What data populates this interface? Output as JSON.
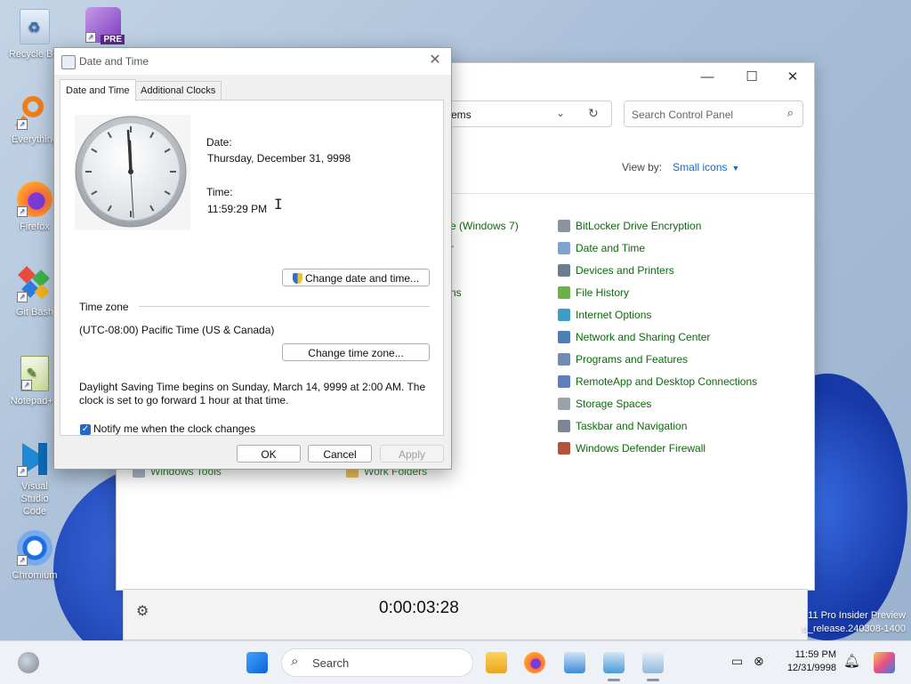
{
  "desktop": {
    "icons": [
      {
        "label": "Recycle Bin",
        "icon": "recycle-bin-icon"
      },
      {
        "label": "Everything",
        "icon": "everything-search-icon"
      },
      {
        "label": "Firefox",
        "icon": "firefox-icon"
      },
      {
        "label": "Git Bash",
        "icon": "git-bash-icon"
      },
      {
        "label": "Notepad++",
        "icon": "notepad-plus-plus-icon"
      },
      {
        "label": "Visual Studio Code",
        "icon": "vscode-icon"
      },
      {
        "label": "Chromium",
        "icon": "chromium-icon"
      }
    ],
    "vs_preview_badge": "PRE",
    "watermark_line1": "11 Pro Insider Preview",
    "watermark_line2": "e_release.240308-1400"
  },
  "control_panel": {
    "address_text": "ems",
    "search_placeholder": "Search Control Panel",
    "view_by_label": "View by:",
    "view_by_value": "Small icons",
    "left_partial_items": [
      "e (Windows 7)",
      "r",
      "ns"
    ],
    "right_items": [
      "BitLocker Drive Encryption",
      "Date and Time",
      "Devices and Printers",
      "File History",
      "Internet Options",
      "Network and Sharing Center",
      "Programs and Features",
      "RemoteApp and Desktop Connections",
      "Storage Spaces",
      "Taskbar and Navigation",
      "Windows Defender Firewall"
    ],
    "bottom_items": [
      "Windows Tools",
      "Work Folders"
    ]
  },
  "stopwatch": {
    "time": "0:00:03:28"
  },
  "dialog": {
    "title": "Date and Time",
    "tabs": [
      "Date and Time",
      "Additional Clocks"
    ],
    "date_label": "Date:",
    "date_value": "Thursday, December 31, 9998",
    "time_label": "Time:",
    "time_value": "11:59:29 PM",
    "change_datetime_button": "Change date and time...",
    "timezone_header": "Time zone",
    "timezone_value": "(UTC-08:00) Pacific Time (US & Canada)",
    "change_timezone_button": "Change time zone...",
    "dst_line1": "Daylight Saving Time begins on Sunday, March 14, 9999 at 2:00 AM. The",
    "dst_line2": "clock is set to go forward 1 hour at that time.",
    "notify_label": "Notify me when the clock changes",
    "ok": "OK",
    "cancel": "Cancel",
    "apply": "Apply"
  },
  "taskbar": {
    "search_placeholder": "Search",
    "clock_time": "11:59 PM",
    "clock_date": "12/31/9998"
  },
  "colors": {
    "accent": "#1f67c8",
    "link_green": "#0b6a0b",
    "link_blue": "#1a66c2"
  }
}
